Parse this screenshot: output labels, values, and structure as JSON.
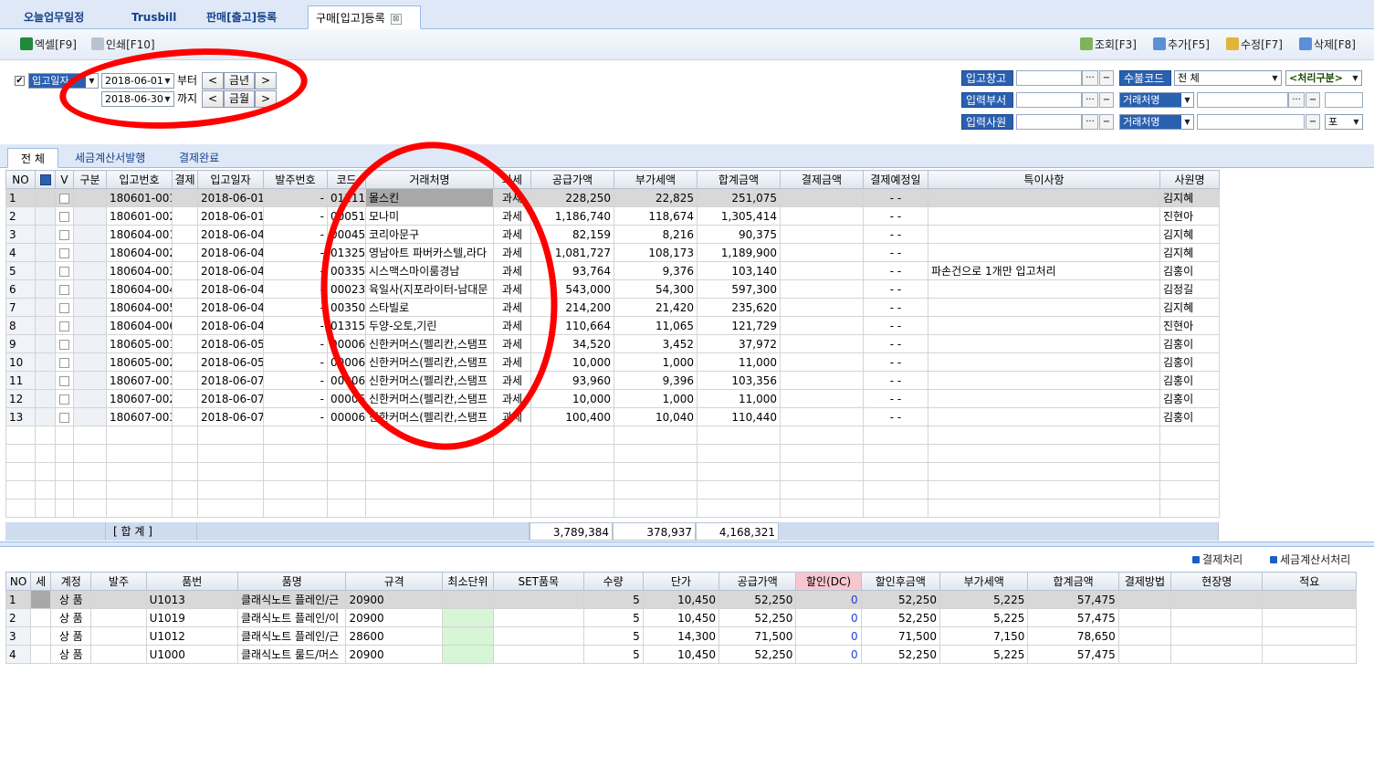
{
  "tabs": [
    {
      "label": "오늘업무일정"
    },
    {
      "label": "Trusbill"
    },
    {
      "label": "판매[출고]등록"
    },
    {
      "label": "구매[입고]등록"
    }
  ],
  "tab_close": "⊠",
  "toolbar": {
    "excel": "엑셀[F9]",
    "print": "인쇄[F10]",
    "search": "조회[F3]",
    "add": "추가[F5]",
    "edit": "수정[F7]",
    "delete": "삭제[F8]"
  },
  "filter": {
    "date_type": "입고일자",
    "from_date": "2018-06-01",
    "to_date": "2018-06-30",
    "from_suffix": "부터",
    "to_suffix": "까지",
    "prev": "<",
    "next": ">",
    "this_year": "금년",
    "this_month": "금월",
    "warehouse_label": "입고창고",
    "flow_code_label": "수불코드",
    "flow_code_value": "전   체",
    "process_type": "<처리구분>",
    "dept_label": "입력부서",
    "partner_label_1": "거래처명",
    "staff_label": "입력사원",
    "partner_label_2": "거래처명",
    "ellipsis": "···",
    "minus": "−",
    "last_select": "포"
  },
  "subtabs": [
    {
      "label": "전 체"
    },
    {
      "label": "세금계산서발행"
    },
    {
      "label": "결제완료"
    }
  ],
  "main_grid": {
    "headers": [
      "NO",
      "",
      "V",
      "구분",
      "입고번호",
      "결제",
      "입고일자",
      "발주번호",
      "코드",
      "거래처명",
      "과세",
      "공급가액",
      "부가세액",
      "합계금액",
      "결제금액",
      "결제예정일",
      "특이사항",
      "사원명"
    ],
    "rows": [
      {
        "no": "1",
        "in_no": "180601-001",
        "date": "2018-06-01",
        "order": "-",
        "code": "01111",
        "partner": "몰스킨",
        "tax": "과세",
        "supply": "228,250",
        "vat": "22,825",
        "total": "251,075",
        "pay_due": "-  -",
        "note": "",
        "staff": "김지혜"
      },
      {
        "no": "2",
        "in_no": "180601-002",
        "date": "2018-06-01",
        "order": "-",
        "code": "00051",
        "partner": "모나미",
        "tax": "과세",
        "supply": "1,186,740",
        "vat": "118,674",
        "total": "1,305,414",
        "pay_due": "-  -",
        "note": "",
        "staff": "진현아"
      },
      {
        "no": "3",
        "in_no": "180604-001",
        "date": "2018-06-04",
        "order": "-",
        "code": "00045",
        "partner": "코리아문구",
        "tax": "과세",
        "supply": "82,159",
        "vat": "8,216",
        "total": "90,375",
        "pay_due": "-  -",
        "note": "",
        "staff": "김지혜"
      },
      {
        "no": "4",
        "in_no": "180604-002",
        "date": "2018-06-04",
        "order": "-",
        "code": "01325",
        "partner": "영남아트 파버카스텔,라다",
        "tax": "과세",
        "supply": "1,081,727",
        "vat": "108,173",
        "total": "1,189,900",
        "pay_due": "-  -",
        "note": "",
        "staff": "김지혜"
      },
      {
        "no": "5",
        "in_no": "180604-003",
        "date": "2018-06-04",
        "order": "-",
        "code": "00335",
        "partner": "시스맥스마이룸경남",
        "tax": "과세",
        "supply": "93,764",
        "vat": "9,376",
        "total": "103,140",
        "pay_due": "-  -",
        "note": "파손건으로 1개만 입고처리",
        "staff": "김홍이"
      },
      {
        "no": "6",
        "in_no": "180604-004",
        "date": "2018-06-04",
        "order": "-",
        "code": "00023",
        "partner": "육일사(지포라이터-남대문",
        "tax": "과세",
        "supply": "543,000",
        "vat": "54,300",
        "total": "597,300",
        "pay_due": "-  -",
        "note": "",
        "staff": "김정길"
      },
      {
        "no": "7",
        "in_no": "180604-005",
        "date": "2018-06-04",
        "order": "-",
        "code": "00350",
        "partner": "스타빌로",
        "tax": "과세",
        "supply": "214,200",
        "vat": "21,420",
        "total": "235,620",
        "pay_due": "-  -",
        "note": "",
        "staff": "김지혜"
      },
      {
        "no": "8",
        "in_no": "180604-006",
        "date": "2018-06-04",
        "order": "-",
        "code": "01315",
        "partner": "두양-오토,기린",
        "tax": "과세",
        "supply": "110,664",
        "vat": "11,065",
        "total": "121,729",
        "pay_due": "-  -",
        "note": "",
        "staff": "진현아"
      },
      {
        "no": "9",
        "in_no": "180605-001",
        "date": "2018-06-05",
        "order": "-",
        "code": "00006",
        "partner": "신한커머스(펠리칸,스탬프",
        "tax": "과세",
        "supply": "34,520",
        "vat": "3,452",
        "total": "37,972",
        "pay_due": "-  -",
        "note": "",
        "staff": "김홍이"
      },
      {
        "no": "10",
        "in_no": "180605-002",
        "date": "2018-06-05",
        "order": "-",
        "code": "00006",
        "partner": "신한커머스(펠리칸,스탬프",
        "tax": "과세",
        "supply": "10,000",
        "vat": "1,000",
        "total": "11,000",
        "pay_due": "-  -",
        "note": "",
        "staff": "김홍이"
      },
      {
        "no": "11",
        "in_no": "180607-001",
        "date": "2018-06-07",
        "order": "-",
        "code": "00006",
        "partner": "신한커머스(펠리칸,스탬프",
        "tax": "과세",
        "supply": "93,960",
        "vat": "9,396",
        "total": "103,356",
        "pay_due": "-  -",
        "note": "",
        "staff": "김홍이"
      },
      {
        "no": "12",
        "in_no": "180607-002",
        "date": "2018-06-07",
        "order": "-",
        "code": "00006",
        "partner": "신한커머스(펠리칸,스탬프",
        "tax": "과세",
        "supply": "10,000",
        "vat": "1,000",
        "total": "11,000",
        "pay_due": "-  -",
        "note": "",
        "staff": "김홍이"
      },
      {
        "no": "13",
        "in_no": "180607-003",
        "date": "2018-06-07",
        "order": "-",
        "code": "00006",
        "partner": "신한커머스(펠리칸,스탬프",
        "tax": "과세",
        "supply": "100,400",
        "vat": "10,040",
        "total": "110,440",
        "pay_due": "-  -",
        "note": "",
        "staff": "김홍이"
      }
    ],
    "sum_label": "[ 합    계 ]",
    "sum_supply": "3,789,384",
    "sum_vat": "378,937",
    "sum_total": "4,168,321"
  },
  "actions": {
    "payment": "결제처리",
    "tax_invoice": "세금계산서처리"
  },
  "detail_grid": {
    "headers": [
      "NO",
      "세",
      "계정",
      "발주",
      "품번",
      "품명",
      "규격",
      "최소단위",
      "SET품목",
      "수량",
      "단가",
      "공급가액",
      "할인(DC)",
      "할인후금액",
      "부가세액",
      "합계금액",
      "결제방법",
      "현장명",
      "적요"
    ],
    "rows": [
      {
        "no": "1",
        "acct": "상  품",
        "item_no": "U1013",
        "item_name": "클래식노트 플레인/근",
        "spec": "20900",
        "qty": "5",
        "price": "10,450",
        "supply": "52,250",
        "dc": "0",
        "after_dc": "52,250",
        "vat": "5,225",
        "total": "57,475"
      },
      {
        "no": "2",
        "acct": "상  품",
        "item_no": "U1019",
        "item_name": "클래식노트 플레인/이",
        "spec": "20900",
        "qty": "5",
        "price": "10,450",
        "supply": "52,250",
        "dc": "0",
        "after_dc": "52,250",
        "vat": "5,225",
        "total": "57,475"
      },
      {
        "no": "3",
        "acct": "상  품",
        "item_no": "U1012",
        "item_name": "클래식노트 플레인/근",
        "spec": "28600",
        "qty": "5",
        "price": "14,300",
        "supply": "71,500",
        "dc": "0",
        "after_dc": "71,500",
        "vat": "7,150",
        "total": "78,650"
      },
      {
        "no": "4",
        "acct": "상  품",
        "item_no": "U1000",
        "item_name": "클래식노트 룰드/머스",
        "spec": "20900",
        "qty": "5",
        "price": "10,450",
        "supply": "52,250",
        "dc": "0",
        "after_dc": "52,250",
        "vat": "5,225",
        "total": "57,475"
      }
    ]
  },
  "colors": {
    "label_blue": "#2a60b0",
    "annotation_red": "#ff0000",
    "header_pink": "#f7c7cf",
    "cell_green": "#d6f6d6"
  }
}
